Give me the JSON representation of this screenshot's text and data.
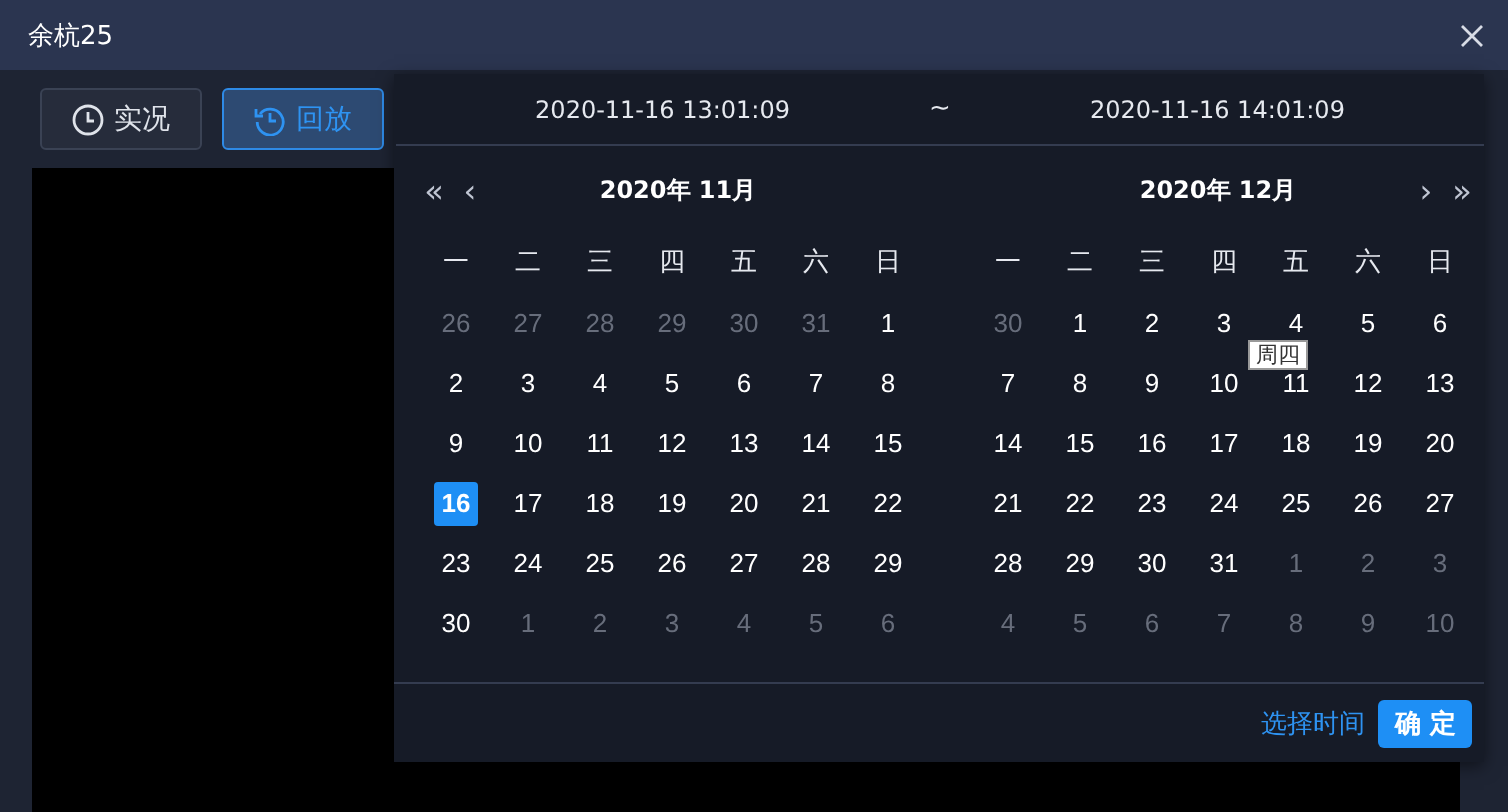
{
  "window": {
    "title": "余杭25"
  },
  "modes": [
    {
      "label": "实况",
      "kind": "live",
      "selected": false
    },
    {
      "label": "回放",
      "kind": "playback",
      "selected": true
    }
  ],
  "range": {
    "start": "2020-11-16 13:01:09",
    "separator": "~",
    "end": "2020-11-16 14:01:09"
  },
  "nav": {
    "prev_year": "«",
    "prev_month": "‹",
    "next_month": "›",
    "next_year": "»"
  },
  "months": [
    {
      "title": "2020年 11月",
      "weekdays": [
        "一",
        "二",
        "三",
        "四",
        "五",
        "六",
        "日"
      ],
      "weeks": [
        [
          {
            "d": "26",
            "other": true,
            "selected": false
          },
          {
            "d": "27",
            "other": true,
            "selected": false
          },
          {
            "d": "28",
            "other": true,
            "selected": false
          },
          {
            "d": "29",
            "other": true,
            "selected": false
          },
          {
            "d": "30",
            "other": true,
            "selected": false
          },
          {
            "d": "31",
            "other": true,
            "selected": false
          },
          {
            "d": "1",
            "other": false,
            "selected": false
          }
        ],
        [
          {
            "d": "2",
            "other": false,
            "selected": false
          },
          {
            "d": "3",
            "other": false,
            "selected": false
          },
          {
            "d": "4",
            "other": false,
            "selected": false
          },
          {
            "d": "5",
            "other": false,
            "selected": false
          },
          {
            "d": "6",
            "other": false,
            "selected": false
          },
          {
            "d": "7",
            "other": false,
            "selected": false
          },
          {
            "d": "8",
            "other": false,
            "selected": false
          }
        ],
        [
          {
            "d": "9",
            "other": false,
            "selected": false
          },
          {
            "d": "10",
            "other": false,
            "selected": false
          },
          {
            "d": "11",
            "other": false,
            "selected": false
          },
          {
            "d": "12",
            "other": false,
            "selected": false
          },
          {
            "d": "13",
            "other": false,
            "selected": false
          },
          {
            "d": "14",
            "other": false,
            "selected": false
          },
          {
            "d": "15",
            "other": false,
            "selected": false
          }
        ],
        [
          {
            "d": "16",
            "other": false,
            "selected": true
          },
          {
            "d": "17",
            "other": false,
            "selected": false
          },
          {
            "d": "18",
            "other": false,
            "selected": false
          },
          {
            "d": "19",
            "other": false,
            "selected": false
          },
          {
            "d": "20",
            "other": false,
            "selected": false
          },
          {
            "d": "21",
            "other": false,
            "selected": false
          },
          {
            "d": "22",
            "other": false,
            "selected": false
          }
        ],
        [
          {
            "d": "23",
            "other": false,
            "selected": false
          },
          {
            "d": "24",
            "other": false,
            "selected": false
          },
          {
            "d": "25",
            "other": false,
            "selected": false
          },
          {
            "d": "26",
            "other": false,
            "selected": false
          },
          {
            "d": "27",
            "other": false,
            "selected": false
          },
          {
            "d": "28",
            "other": false,
            "selected": false
          },
          {
            "d": "29",
            "other": false,
            "selected": false
          }
        ],
        [
          {
            "d": "30",
            "other": false,
            "selected": false
          },
          {
            "d": "1",
            "other": true,
            "selected": false
          },
          {
            "d": "2",
            "other": true,
            "selected": false
          },
          {
            "d": "3",
            "other": true,
            "selected": false
          },
          {
            "d": "4",
            "other": true,
            "selected": false
          },
          {
            "d": "5",
            "other": true,
            "selected": false
          },
          {
            "d": "6",
            "other": true,
            "selected": false
          }
        ]
      ]
    },
    {
      "title": "2020年 12月",
      "weekdays": [
        "一",
        "二",
        "三",
        "四",
        "五",
        "六",
        "日"
      ],
      "weeks": [
        [
          {
            "d": "30",
            "other": true,
            "selected": false
          },
          {
            "d": "1",
            "other": false,
            "selected": false
          },
          {
            "d": "2",
            "other": false,
            "selected": false
          },
          {
            "d": "3",
            "other": false,
            "selected": false
          },
          {
            "d": "4",
            "other": false,
            "selected": false
          },
          {
            "d": "5",
            "other": false,
            "selected": false
          },
          {
            "d": "6",
            "other": false,
            "selected": false
          }
        ],
        [
          {
            "d": "7",
            "other": false,
            "selected": false
          },
          {
            "d": "8",
            "other": false,
            "selected": false
          },
          {
            "d": "9",
            "other": false,
            "selected": false
          },
          {
            "d": "10",
            "other": false,
            "selected": false
          },
          {
            "d": "11",
            "other": false,
            "selected": false
          },
          {
            "d": "12",
            "other": false,
            "selected": false
          },
          {
            "d": "13",
            "other": false,
            "selected": false
          }
        ],
        [
          {
            "d": "14",
            "other": false,
            "selected": false
          },
          {
            "d": "15",
            "other": false,
            "selected": false
          },
          {
            "d": "16",
            "other": false,
            "selected": false
          },
          {
            "d": "17",
            "other": false,
            "selected": false
          },
          {
            "d": "18",
            "other": false,
            "selected": false
          },
          {
            "d": "19",
            "other": false,
            "selected": false
          },
          {
            "d": "20",
            "other": false,
            "selected": false
          }
        ],
        [
          {
            "d": "21",
            "other": false,
            "selected": false
          },
          {
            "d": "22",
            "other": false,
            "selected": false
          },
          {
            "d": "23",
            "other": false,
            "selected": false
          },
          {
            "d": "24",
            "other": false,
            "selected": false
          },
          {
            "d": "25",
            "other": false,
            "selected": false
          },
          {
            "d": "26",
            "other": false,
            "selected": false
          },
          {
            "d": "27",
            "other": false,
            "selected": false
          }
        ],
        [
          {
            "d": "28",
            "other": false,
            "selected": false
          },
          {
            "d": "29",
            "other": false,
            "selected": false
          },
          {
            "d": "30",
            "other": false,
            "selected": false
          },
          {
            "d": "31",
            "other": false,
            "selected": false
          },
          {
            "d": "1",
            "other": true,
            "selected": false
          },
          {
            "d": "2",
            "other": true,
            "selected": false
          },
          {
            "d": "3",
            "other": true,
            "selected": false
          }
        ],
        [
          {
            "d": "4",
            "other": true,
            "selected": false
          },
          {
            "d": "5",
            "other": true,
            "selected": false
          },
          {
            "d": "6",
            "other": true,
            "selected": false
          },
          {
            "d": "7",
            "other": true,
            "selected": false
          },
          {
            "d": "8",
            "other": true,
            "selected": false
          },
          {
            "d": "9",
            "other": true,
            "selected": false
          },
          {
            "d": "10",
            "other": true,
            "selected": false
          }
        ]
      ]
    }
  ],
  "tooltip": {
    "text": "周四"
  },
  "footer": {
    "link": "选择时间",
    "confirm": "确 定"
  }
}
